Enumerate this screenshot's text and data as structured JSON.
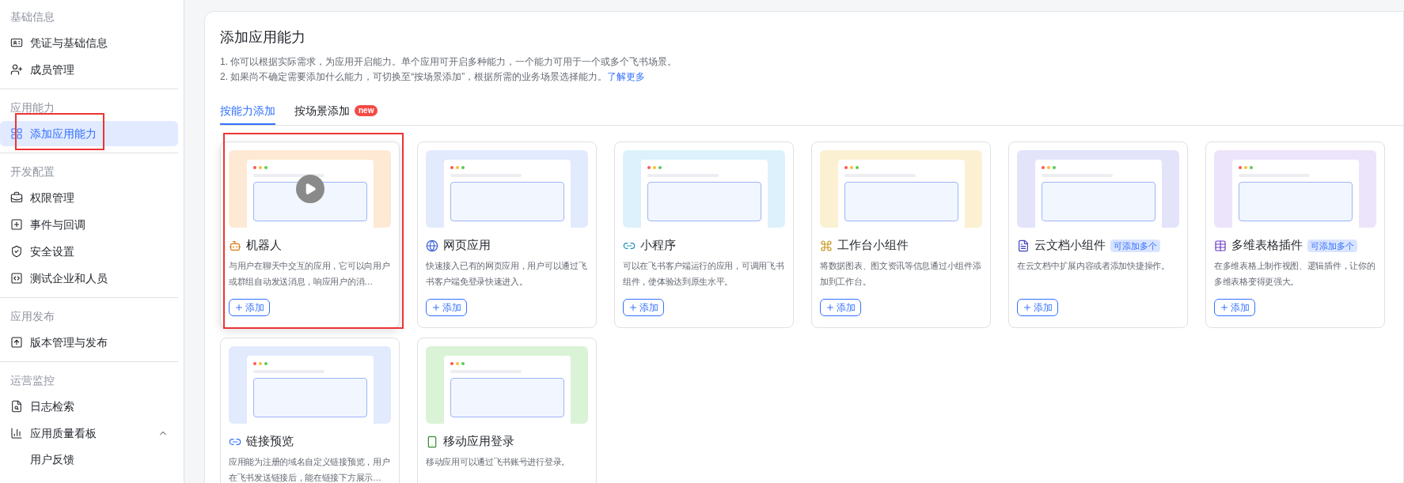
{
  "sidebar": {
    "sections": [
      {
        "title": "基础信息",
        "items": [
          {
            "label": "凭证与基础信息",
            "selected": false
          },
          {
            "label": "成员管理",
            "selected": false
          }
        ]
      },
      {
        "title": "应用能力",
        "items": [
          {
            "label": "添加应用能力",
            "selected": true,
            "annotated": true
          }
        ]
      },
      {
        "title": "开发配置",
        "items": [
          {
            "label": "权限管理",
            "selected": false
          },
          {
            "label": "事件与回调",
            "selected": false
          },
          {
            "label": "安全设置",
            "selected": false
          },
          {
            "label": "测试企业和人员",
            "selected": false
          }
        ]
      },
      {
        "title": "应用发布",
        "items": [
          {
            "label": "版本管理与发布",
            "selected": false
          }
        ]
      },
      {
        "title": "运营监控",
        "items": [
          {
            "label": "日志检索",
            "selected": false
          },
          {
            "label": "应用质量看板",
            "selected": false,
            "expanded": true,
            "children": [
              {
                "label": "用户反馈",
                "selected": false
              }
            ]
          }
        ]
      }
    ]
  },
  "page": {
    "title": "添加应用能力",
    "notes": [
      "1. 你可以根据实际需求，为应用开启能力。单个应用可开启多种能力，一个能力可用于一个或多个飞书场景。",
      "2. 如果尚不确定需要添加什么能力，可切换至“按场景添加”，根据所需的业务场景选择能力。"
    ],
    "link": "了解更多"
  },
  "tabs": [
    {
      "label": "按能力添加",
      "selected": true
    },
    {
      "label": "按场景添加",
      "selected": false,
      "badge": "new"
    }
  ],
  "cards": [
    {
      "title": "机器人",
      "description": "与用户在聊天中交互的应用，它可以向用户或群组自动发送消息，响应用户的消…",
      "button": "添加",
      "color": "#fde9d4",
      "kind": "video",
      "annotated": true
    },
    {
      "title": "网页应用",
      "description": "快速接入已有的网页应用，用户可以通过飞书客户端免登录快速进入。",
      "button": "添加",
      "color": "#e2eafd",
      "kind": "image"
    },
    {
      "title": "小程序",
      "description": "可以在飞书客户端运行的应用，可调用飞书组件，使体验达到原生水平。",
      "button": "添加",
      "color": "#dcf1fb",
      "kind": "image"
    },
    {
      "title": "工作台小组件",
      "description": "将数据图表、图文资讯等信息通过小组件添加到工作台。",
      "button": "添加",
      "color": "#fbf0d2",
      "kind": "image"
    },
    {
      "title": "云文档小组件",
      "badge": "可添加多个",
      "description": "在云文档中扩展内容或者添加快捷操作。",
      "button": "添加",
      "color": "#e3e4fa",
      "kind": "image"
    },
    {
      "title": "多维表格插件",
      "badge": "可添加多个",
      "description": "在多维表格上制作视图、逻辑插件，让你的多维表格变得更强大。",
      "button": "添加",
      "color": "#ece4fb",
      "kind": "image"
    },
    {
      "title": "链接预览",
      "description": "应用能为注册的域名自定义链接预览，用户在飞书发送链接后，能在链接下方展示…",
      "color": "#e2eafd",
      "kind": "image"
    },
    {
      "title": "移动应用登录",
      "description": "移动应用可以通过飞书账号进行登录。",
      "color": "#daf3d6",
      "kind": "image"
    }
  ]
}
